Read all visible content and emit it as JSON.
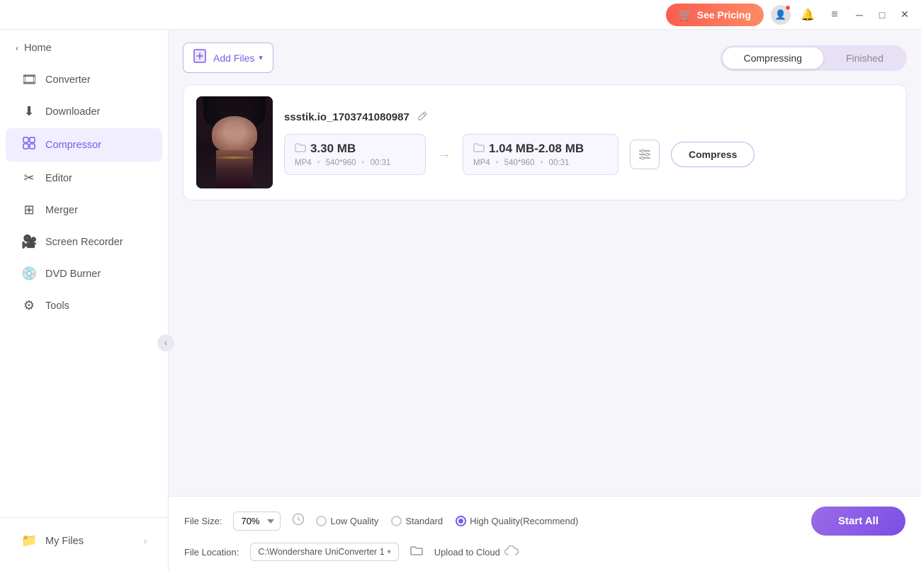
{
  "titlebar": {
    "see_pricing_label": "See Pricing",
    "fire_emoji": "🛒"
  },
  "sidebar": {
    "home_label": "Home",
    "items": [
      {
        "id": "converter",
        "label": "Converter",
        "icon": "🎞"
      },
      {
        "id": "downloader",
        "label": "Downloader",
        "icon": "⬇"
      },
      {
        "id": "compressor",
        "label": "Compressor",
        "icon": "🗜",
        "active": true
      },
      {
        "id": "editor",
        "label": "Editor",
        "icon": "✂"
      },
      {
        "id": "merger",
        "label": "Merger",
        "icon": "🔗"
      },
      {
        "id": "screen-recorder",
        "label": "Screen Recorder",
        "icon": "🎥"
      },
      {
        "id": "dvd-burner",
        "label": "DVD Burner",
        "icon": "💿"
      },
      {
        "id": "tools",
        "label": "Tools",
        "icon": "⚙"
      }
    ],
    "my_files_label": "My Files"
  },
  "content": {
    "add_file_label": "Add Files",
    "tabs": [
      {
        "id": "compressing",
        "label": "Compressing",
        "active": true
      },
      {
        "id": "finished",
        "label": "Finished",
        "active": false
      }
    ],
    "file": {
      "name": "ssstik.io_1703741080987",
      "original_size": "3.30 MB",
      "original_format": "MP4",
      "original_resolution": "540*960",
      "original_duration": "00:31",
      "target_size": "1.04 MB-2.08 MB",
      "target_format": "MP4",
      "target_resolution": "540*960",
      "target_duration": "00:31",
      "compress_label": "Compress"
    }
  },
  "bottom_bar": {
    "file_size_label": "File Size:",
    "file_size_value": "70%",
    "quality_options": [
      {
        "id": "low",
        "label": "Low Quality",
        "checked": false
      },
      {
        "id": "standard",
        "label": "Standard",
        "checked": false
      },
      {
        "id": "high",
        "label": "High Quality(Recommend)",
        "checked": true
      }
    ],
    "file_location_label": "File Location:",
    "file_location_value": "C:\\Wondershare UniConverter 1",
    "upload_cloud_label": "Upload to Cloud",
    "start_all_label": "Start All"
  }
}
